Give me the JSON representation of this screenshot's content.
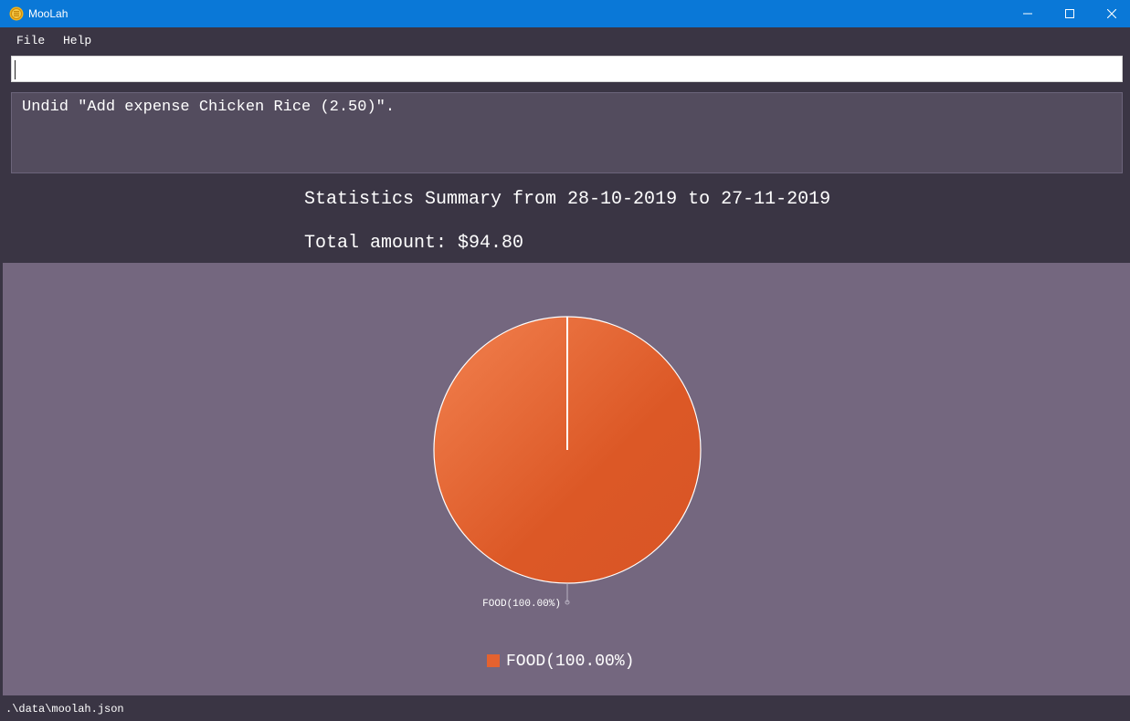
{
  "window": {
    "title": "MooLah",
    "icon": "coin-stack-icon",
    "controls": [
      "minimize-icon",
      "maximize-icon",
      "close-icon"
    ]
  },
  "menu": {
    "items": [
      {
        "label": "File"
      },
      {
        "label": "Help"
      }
    ]
  },
  "command": {
    "value": "",
    "placeholder": ""
  },
  "result": {
    "message": "Undid \"Add expense Chicken Rice (2.50)\"."
  },
  "stats": {
    "summary": "Statistics Summary from 28-10-2019 to 27-11-2019",
    "total": "Total amount: $94.80"
  },
  "chart_data": {
    "type": "pie",
    "categories": [
      "FOOD"
    ],
    "values": [
      100.0
    ],
    "slice_labels": [
      "FOOD(100.00%)"
    ],
    "legend": [
      "FOOD(100.00%)"
    ],
    "legend_position": "bottom",
    "colors": [
      "#e4622f"
    ]
  },
  "status": {
    "path": ".\\data\\moolah.json"
  },
  "colors": {
    "titlebar": "#0a78d7",
    "background": "#3a3544",
    "result_box": "#534c5e",
    "chart_background": "#74677f",
    "food_slice": "#e4622f"
  }
}
